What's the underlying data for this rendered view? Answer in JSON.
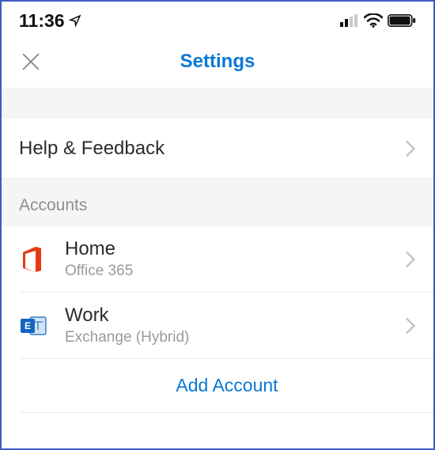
{
  "status": {
    "time": "11:36"
  },
  "nav": {
    "title": "Settings"
  },
  "help": {
    "label": "Help & Feedback"
  },
  "accounts": {
    "header": "Accounts",
    "items": [
      {
        "title": "Home",
        "subtitle": "Office 365",
        "icon": "office365"
      },
      {
        "title": "Work",
        "subtitle": "Exchange (Hybrid)",
        "icon": "exchange"
      }
    ],
    "add_label": "Add Account"
  }
}
